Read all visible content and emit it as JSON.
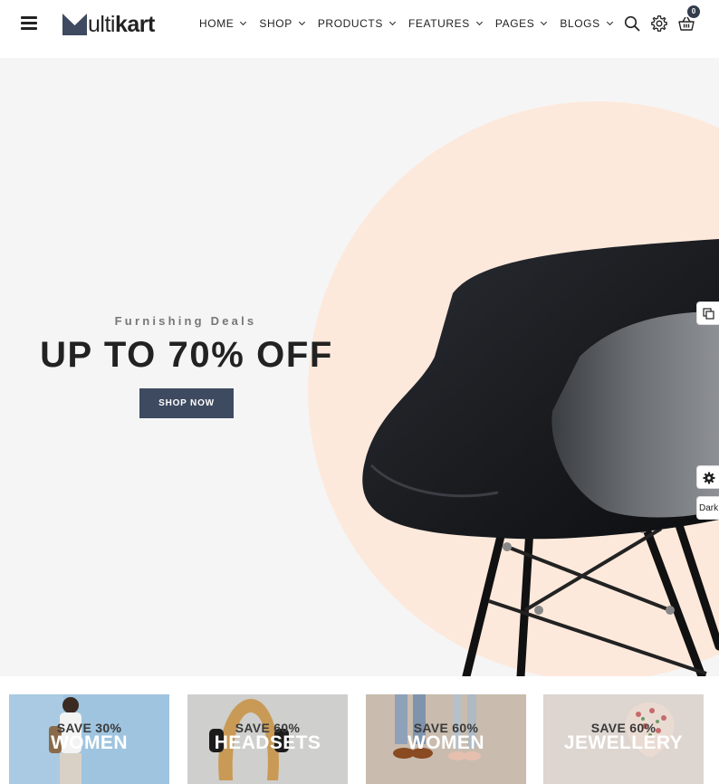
{
  "brand": {
    "logo_letter": "M",
    "name_thin": "ulti",
    "name_bold": "kart"
  },
  "nav": {
    "items": [
      {
        "label": "HOME"
      },
      {
        "label": "SHOP"
      },
      {
        "label": "PRODUCTS"
      },
      {
        "label": "FEATURES"
      },
      {
        "label": "PAGES"
      },
      {
        "label": "BLOGS"
      }
    ]
  },
  "header_icons": {
    "search": "search-icon",
    "settings": "gear-icon",
    "cart": "basket-icon",
    "cart_count": "0"
  },
  "hero": {
    "subtitle": "Furnishing Deals",
    "title": "UP TO 70% OFF",
    "button_label": "SHOP NOW"
  },
  "side_tools": {
    "dark_label": "Dark"
  },
  "banners": [
    {
      "save": "SAVE 30%",
      "category": "WOMEN"
    },
    {
      "save": "SAVE 60%",
      "category": "HEADSETS"
    },
    {
      "save": "SAVE 60%",
      "category": "WOMEN"
    },
    {
      "save": "SAVE 60%",
      "category": "JEWELLERY"
    }
  ],
  "colors": {
    "accent": "#3e4a60",
    "hero_bg": "#f5f5f5",
    "circle": "#fde9dc",
    "text": "#222222"
  }
}
